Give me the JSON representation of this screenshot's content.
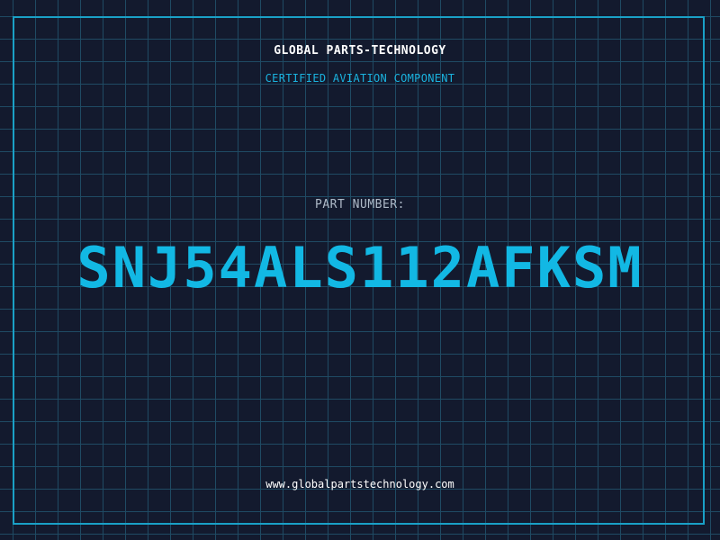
{
  "header": {
    "company": "GLOBAL PARTS-TECHNOLOGY",
    "subtitle": "CERTIFIED AVIATION COMPONENT"
  },
  "part": {
    "label": "PART NUMBER:",
    "number": "SNJ54ALS112AFKSM"
  },
  "footer": {
    "url": "www.globalpartstechnology.com"
  },
  "colors": {
    "background": "#131a2e",
    "grid": "#1f4a63",
    "accent": "#12b8e4",
    "frame": "#1aa0c6"
  }
}
